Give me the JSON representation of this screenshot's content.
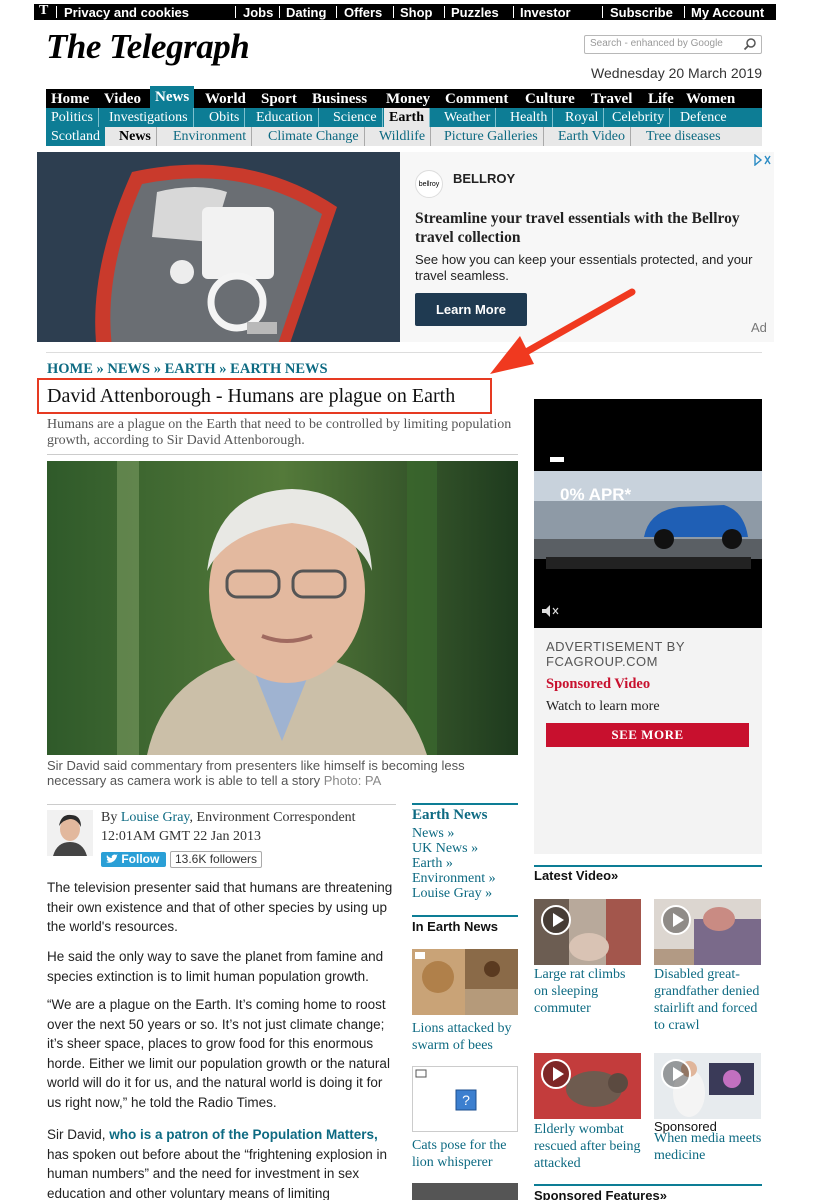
{
  "topbar": {
    "logo": "T",
    "links": [
      "Privacy and cookies",
      "Jobs",
      "Dating",
      "Offers",
      "Shop",
      "Puzzles",
      "Investor"
    ],
    "subscribe": "Subscribe",
    "account": "My Account"
  },
  "masthead": {
    "title": "The Telegraph"
  },
  "search": {
    "placeholder": "Search - enhanced by Google"
  },
  "date": "Wednesday 20 March 2019",
  "nav": {
    "primary": [
      "Home",
      "Video",
      "News",
      "World",
      "Sport",
      "Business",
      "Money",
      "Comment",
      "Culture",
      "Travel",
      "Life",
      "Women"
    ],
    "primary_active": "News",
    "secondary": [
      "Politics",
      "Investigations",
      "Obits",
      "Education",
      "Science",
      "Earth",
      "Weather",
      "Health",
      "Royal",
      "Celebrity",
      "Defence"
    ],
    "secondary_active": "Earth",
    "tertiary": [
      "Scotland",
      "News",
      "Environment",
      "Climate Change",
      "Wildlife",
      "Picture Galleries",
      "Earth Video",
      "Tree diseases"
    ],
    "tertiary_active": "News"
  },
  "ad": {
    "brand": "BELLROY",
    "logo_text": "bellroy",
    "headline": "Streamline your travel essentials with the Bellroy travel collection",
    "body": "See how you can keep your essentials protected, and your travel seamless.",
    "cta": "Learn More",
    "label": "Ad",
    "adchoices_icon": "adchoices-icon"
  },
  "breadcrumb": "HOME » NEWS » EARTH » EARTH NEWS",
  "article": {
    "title": "David Attenborough - Humans are plague on Earth",
    "standfirst": "Humans are a plague on the Earth that need to be controlled by limiting population growth, according to Sir David Attenborough.",
    "caption": "Sir David said commentary from presenters like himself is becoming less necessary as camera work is able to tell a story",
    "credit": "Photo: PA",
    "byline_prefix": "By",
    "author": "Louise Gray",
    "role": ", Environment Correspondent",
    "timestamp": "12:01AM GMT 22 Jan 2013",
    "follow": "Follow",
    "followers": "13.6K followers",
    "paragraphs": [
      "The television presenter said that humans are threatening their own existence and that of other species by using up the world's resources.",
      "He said the only way to save the planet from famine and species extinction is to limit human population growth.",
      "“We are a plague on the Earth. It’s coming home to roost over the next 50 years or so. It’s not just climate change; it’s sheer space, places to grow food for this enormous horde. Either we limit our population growth or the natural world will do it for us, and the natural world is doing it for us right now,” he told the Radio Times."
    ],
    "p4_start": "Sir David, ",
    "p4_link": "who is a patron of the Population Matters,",
    "p4_rest": "has spoken out before about the “frightening explosion in human numbers” and the need for investment in sex education and other voluntary means of limiting"
  },
  "inline_col": {
    "head": "Earth News",
    "links": [
      "News »",
      "UK News »",
      "Earth »",
      "Environment »",
      "Louise Gray »"
    ],
    "in_earth_head": "In Earth News",
    "stories": [
      "Lions attacked by swarm of bees",
      "Cats pose for the lion whisperer"
    ]
  },
  "rail": {
    "video_price": "0% APR*",
    "advert_by": "ADVERTISEMENT BY",
    "advertiser": "FCAGROUP.COM",
    "sponsored": "Sponsored Video",
    "watch": "Watch to learn more",
    "see_more": "SEE MORE",
    "latest_head": "Latest Video»",
    "videos": [
      "Large rat climbs on sleeping commuter",
      "Disabled great-grandfather denied stairlift and forced to crawl",
      "Elderly wombat rescued after being attacked",
      "When media meets medicine"
    ],
    "sponsored_label": "Sponsored",
    "sponsored_features": "Sponsored Features»"
  },
  "colors": {
    "accent": "#0d7d95",
    "highlight": "#e63a22",
    "sponsored": "#c8102e"
  }
}
